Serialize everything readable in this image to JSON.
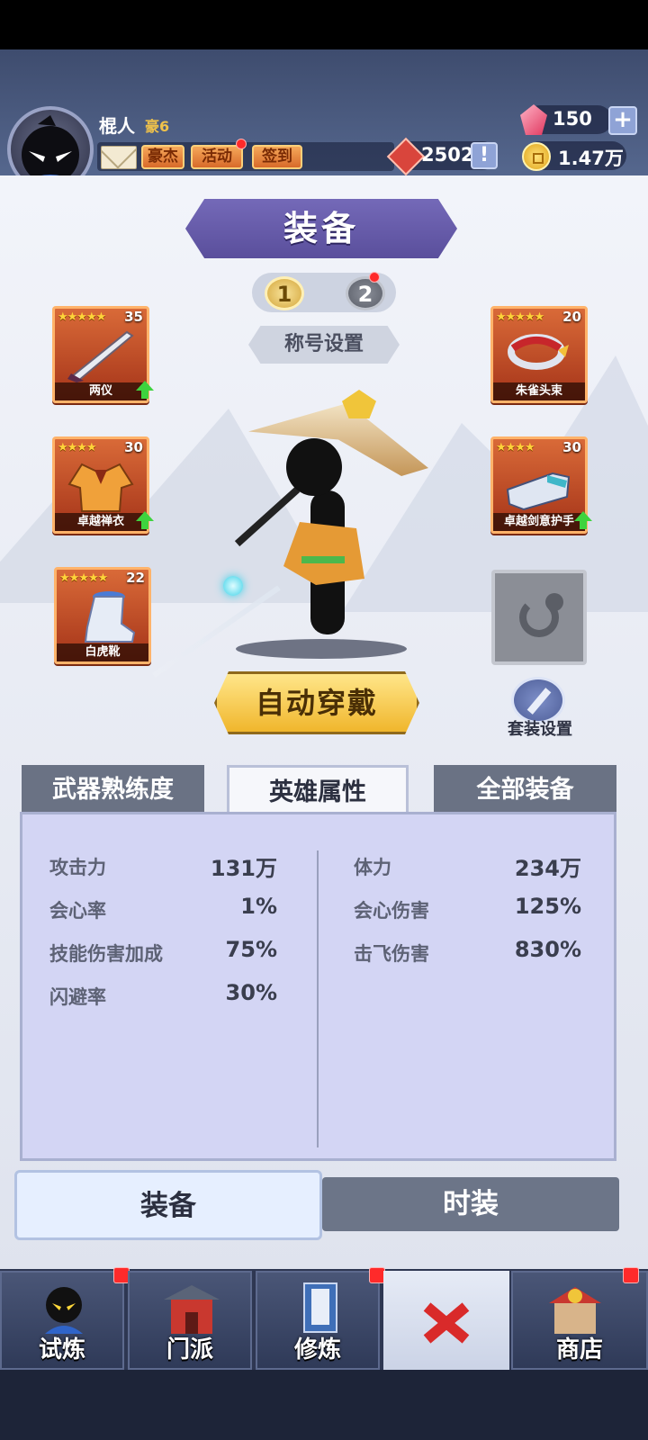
{
  "player": {
    "name": "棍人",
    "vip": "豪6"
  },
  "header_buttons": {
    "heroes": "豪杰",
    "events": "活动",
    "checkin": "签到"
  },
  "currency": {
    "gems": "150",
    "tokens": "2502",
    "coins": "1.47万",
    "plus": "+",
    "info": "!"
  },
  "page_title": "装备",
  "loadouts": [
    "1",
    "2"
  ],
  "title_setting": "称号设置",
  "equipment_left": [
    {
      "name": "两仪",
      "stars": "★★★★★",
      "level": "35",
      "upgrade": true
    },
    {
      "name": "卓越禅衣",
      "stars": "★★★★",
      "level": "30",
      "upgrade": true
    },
    {
      "name": "白虎靴",
      "stars": "★★★★★",
      "level": "22",
      "upgrade": false
    }
  ],
  "equipment_right": [
    {
      "name": "朱雀头束",
      "stars": "★★★★★",
      "level": "20",
      "upgrade": false
    },
    {
      "name": "卓越剑意护手",
      "stars": "★★★★",
      "level": "30",
      "upgrade": true
    }
  ],
  "auto_equip": "自动穿戴",
  "set_setting": "套装设置",
  "stat_tabs": {
    "weapon_mastery": "武器熟练度",
    "hero_attributes": "英雄属性",
    "all_equipment": "全部装备"
  },
  "stats_left": [
    {
      "label": "攻击力",
      "value": "131万"
    },
    {
      "label": "会心率",
      "value": "1%"
    },
    {
      "label": "技能伤害加成",
      "value": "75%"
    },
    {
      "label": "闪避率",
      "value": "30%"
    }
  ],
  "stats_right": [
    {
      "label": "体力",
      "value": "234万"
    },
    {
      "label": "会心伤害",
      "value": "125%"
    },
    {
      "label": "击飞伤害",
      "value": "830%"
    }
  ],
  "sub_tabs": {
    "equipment": "装备",
    "fashion": "时装"
  },
  "bottom_nav": {
    "trial": "试炼",
    "sect": "门派",
    "cultivate": "修炼",
    "shop": "商店"
  },
  "colors": {
    "accent_purple": "#5a4f9c",
    "gold": "#f0b62c",
    "slot_orange": "#d96a38",
    "notify_red": "#ff2a2a"
  }
}
